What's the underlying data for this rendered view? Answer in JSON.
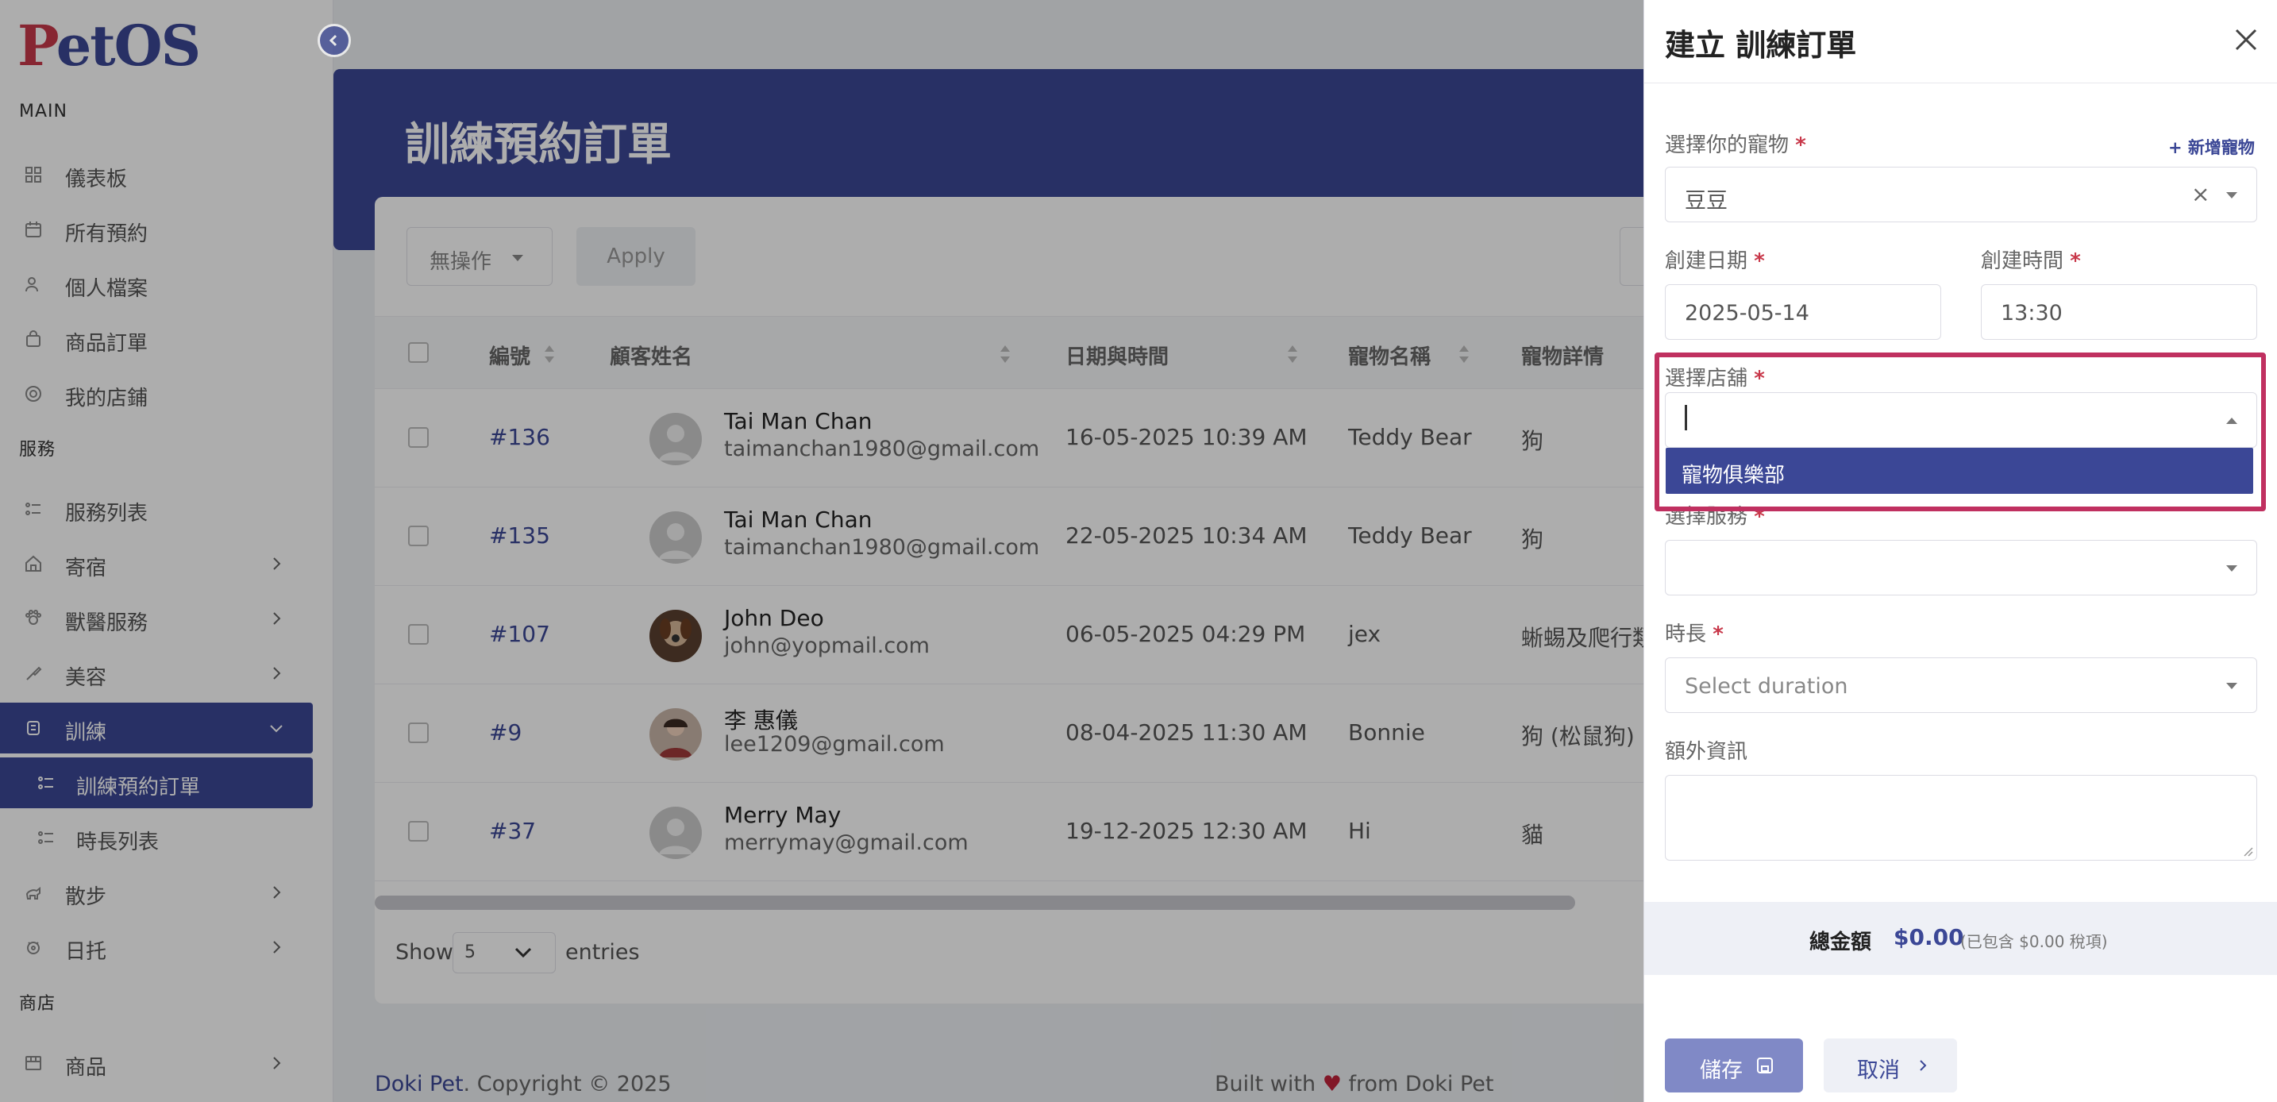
{
  "brand": {
    "logo_p": "P",
    "logo_rest": "etOS"
  },
  "sidebar": {
    "main_section": "MAIN",
    "main_items": [
      {
        "label": "儀表板",
        "icon": "grid-icon"
      },
      {
        "label": "所有預約",
        "icon": "calendar-icon"
      },
      {
        "label": "個人檔案",
        "icon": "user-icon"
      },
      {
        "label": "商品訂單",
        "icon": "shopping-bag-icon"
      },
      {
        "label": "我的店鋪",
        "icon": "store-icon"
      }
    ],
    "service_section": "服務",
    "service_items": [
      {
        "label": "服務列表",
        "icon": "list-icon"
      },
      {
        "label": "寄宿",
        "icon": "home-icon"
      },
      {
        "label": "獸醫服務",
        "icon": "vet-icon"
      },
      {
        "label": "美容",
        "icon": "grooming-icon"
      },
      {
        "label": "訓練",
        "icon": "training-icon"
      },
      {
        "label": "訓練預約訂單",
        "icon": "list-icon"
      },
      {
        "label": "時長列表",
        "icon": "list-icon"
      },
      {
        "label": "散步",
        "icon": "walk-icon"
      },
      {
        "label": "日托",
        "icon": "daycare-icon"
      }
    ],
    "shop_section": "商店",
    "shop_items": [
      {
        "label": "商品",
        "icon": "shop-icon"
      }
    ]
  },
  "page": {
    "title": "訓練預約訂單"
  },
  "toolbar": {
    "bulk_action": "無操作",
    "apply": "Apply"
  },
  "table": {
    "columns": [
      "編號",
      "顧客姓名",
      "日期與時間",
      "寵物名稱",
      "寵物詳情"
    ],
    "rows": [
      {
        "id": "#136",
        "name": "Tai Man Chan",
        "email": "taimanchan1980@gmail.com",
        "datetime": "16-05-2025 10:39 AM",
        "pet": "Teddy Bear",
        "detail": "狗"
      },
      {
        "id": "#135",
        "name": "Tai Man Chan",
        "email": "taimanchan1980@gmail.com",
        "datetime": "22-05-2025 10:34 AM",
        "pet": "Teddy Bear",
        "detail": "狗"
      },
      {
        "id": "#107",
        "name": "John Deo",
        "email": "john@yopmail.com",
        "datetime": "06-05-2025 04:29 PM",
        "pet": "jex",
        "detail": "蜥蜴及爬行類 (豹紋"
      },
      {
        "id": "#9",
        "name": "李 惠儀",
        "email": "lee1209@gmail.com",
        "datetime": "08-04-2025 11:30 AM",
        "pet": "Bonnie",
        "detail": "狗 (松鼠狗)"
      },
      {
        "id": "#37",
        "name": "Merry May",
        "email": "merrymay@gmail.com",
        "datetime": "19-12-2025 12:30 AM",
        "pet": "Hi",
        "detail": "貓"
      }
    ],
    "show_label": "Show",
    "page_size": "5",
    "entries_label": "entries"
  },
  "footer": {
    "brand": "Doki Pet",
    "copyright": ". Copyright © 2025",
    "built_prefix": "Built with",
    "heart": "♥",
    "built_suffix": "from Doki Pet"
  },
  "drawer": {
    "title": "建立 訓練訂單",
    "pet_label": "選擇你的寵物",
    "add_pet": "+ 新增寵物",
    "pet_value": "豆豆",
    "date_label": "創建日期",
    "date_value": "2025-05-14",
    "time_label": "創建時間",
    "time_value": "13:30",
    "store_label": "選擇店舖",
    "store_input": "",
    "store_options": [
      "寵物俱樂部"
    ],
    "service_label": "選擇服務",
    "service_value": "",
    "duration_label": "時長",
    "duration_placeholder": "Select duration",
    "extra_label": "額外資訊",
    "extra_value": "",
    "required_mark": "*",
    "total_label": "總金額",
    "total_amount": "$0.00",
    "total_tax": "(已包含 $0.00 稅項)",
    "save": "儲存",
    "cancel": "取消"
  },
  "colors": {
    "primary": "#3b4796",
    "logo_red": "#c8384a",
    "highlight": "#c03060",
    "required": "#c8384a"
  }
}
